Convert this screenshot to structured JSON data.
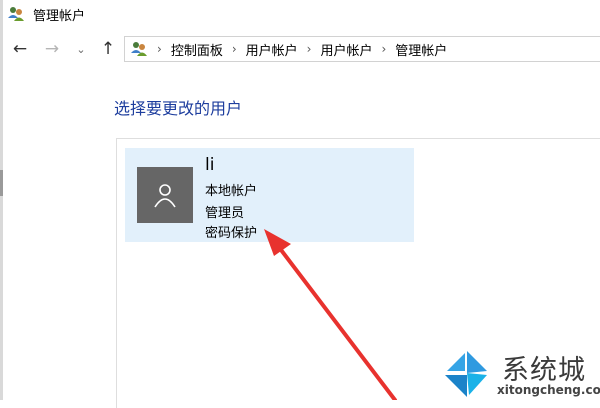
{
  "window": {
    "title": "管理帐户",
    "title_icon": "users-icon"
  },
  "nav": {
    "back_icon": "arrow-left-icon",
    "forward_icon": "arrow-right-icon",
    "recent_icon": "chevron-down-icon",
    "up_icon": "arrow-up-icon"
  },
  "address": {
    "icon": "users-icon",
    "breadcrumbs": [
      "控制面板",
      "用户帐户",
      "用户帐户",
      "管理帐户"
    ]
  },
  "main": {
    "heading": "选择要更改的用户",
    "user": {
      "name": "li",
      "type": "本地帐户",
      "role": "管理员",
      "status": "密码保护",
      "avatar_icon": "person-icon"
    }
  },
  "annotation": {
    "arrow_color": "#e8322e"
  },
  "watermark": {
    "title": "系统城",
    "url": "xitongcheng.com",
    "colors": [
      "#2f9ae0",
      "#1ab2e8"
    ]
  },
  "colors": {
    "heading": "#1e3e9e",
    "tile_bg": "#e2f0fb",
    "avatar_bg": "#666666"
  }
}
